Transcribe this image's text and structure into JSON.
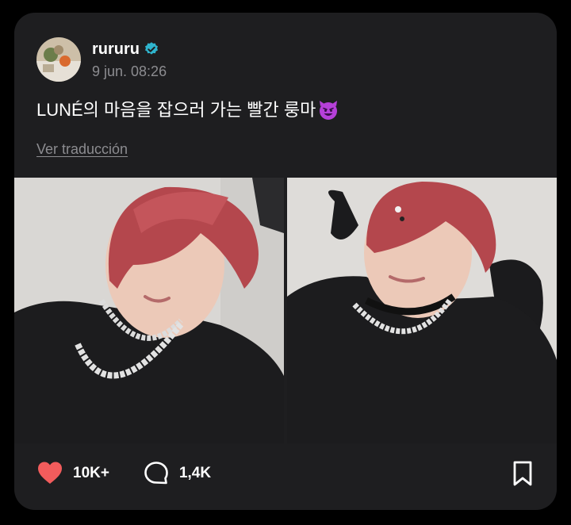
{
  "post": {
    "username": "rururu",
    "timestamp": "9 jun. 08:26",
    "text": "LUNÉ의 마음을 잡으러 가는 빨간 룽마",
    "emoji": "smiling-devil-icon",
    "translate_label": "Ver traducción"
  },
  "media": [
    {
      "alt_name": "photo-1"
    },
    {
      "alt_name": "photo-2"
    }
  ],
  "actions": {
    "likes": "10K+",
    "comments": "1,4K"
  },
  "colors": {
    "background": "#000000",
    "card": "#1e1e20",
    "verified": "#2fb5ce",
    "like": "#f25c5c",
    "muted_text": "#8c8c90",
    "emoji": "#b640d9"
  }
}
